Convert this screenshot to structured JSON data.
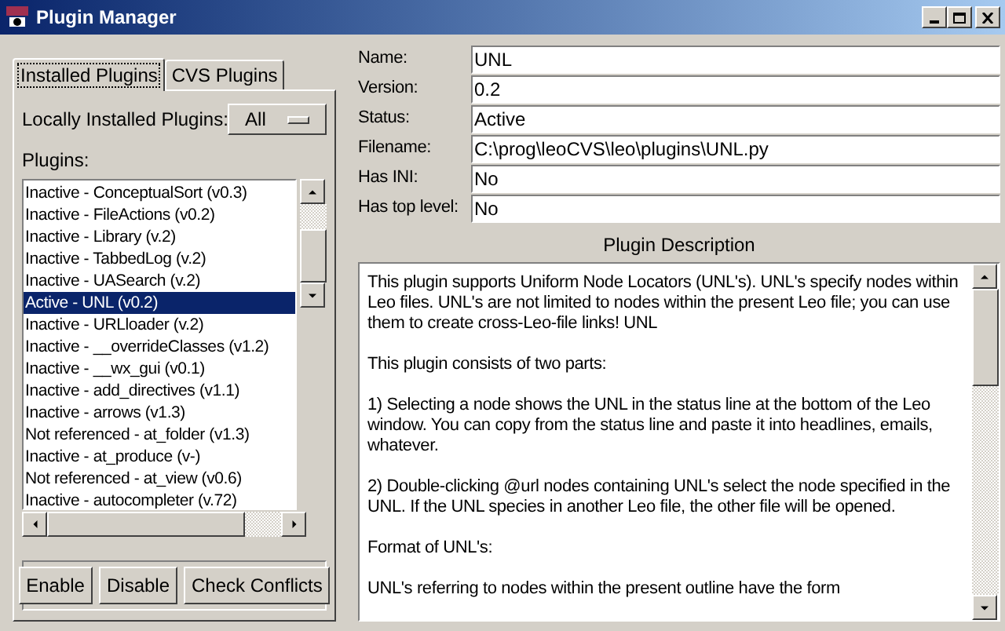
{
  "window": {
    "title": "Plugin Manager"
  },
  "tabs": [
    {
      "label": "Installed Plugins",
      "selected": true
    },
    {
      "label": "CVS Plugins",
      "selected": false
    }
  ],
  "filter": {
    "label": "Locally Installed Plugins:",
    "value": "All"
  },
  "plugins": {
    "label": "Plugins:",
    "items": [
      {
        "text": "Inactive - ConceptualSort (v0.3)",
        "selected": false
      },
      {
        "text": "Inactive - FileActions (v0.2)",
        "selected": false
      },
      {
        "text": "Inactive - Library (v.2)",
        "selected": false
      },
      {
        "text": "Inactive - TabbedLog (v.2)",
        "selected": false
      },
      {
        "text": "Inactive - UASearch (v.2)",
        "selected": false
      },
      {
        "text": "Active - UNL (v0.2)",
        "selected": true
      },
      {
        "text": "Inactive - URLloader (v.2)",
        "selected": false
      },
      {
        "text": "Inactive - __overrideClasses (v1.2)",
        "selected": false
      },
      {
        "text": "Inactive - __wx_gui (v0.1)",
        "selected": false
      },
      {
        "text": "Inactive - add_directives (v1.1)",
        "selected": false
      },
      {
        "text": "Inactive - arrows (v1.3)",
        "selected": false
      },
      {
        "text": "Not referenced - at_folder (v1.3)",
        "selected": false
      },
      {
        "text": "Inactive - at_produce (v-)",
        "selected": false
      },
      {
        "text": "Not referenced - at_view (v0.6)",
        "selected": false
      },
      {
        "text": "Inactive - autocompleter (v.72)",
        "selected": false
      }
    ]
  },
  "buttons": [
    "Enable",
    "Disable",
    "Check Conflicts"
  ],
  "details": [
    {
      "label": "Name:",
      "value": "UNL"
    },
    {
      "label": "Version:",
      "value": "0.2"
    },
    {
      "label": "Status:",
      "value": "Active"
    },
    {
      "label": "Filename:",
      "value": "C:\\prog\\leoCVS\\leo\\plugins\\UNL.py"
    },
    {
      "label": "Has INI:",
      "value": "No"
    },
    {
      "label": "Has top level:",
      "value": "No"
    }
  ],
  "description": {
    "title": "Plugin Description",
    "paragraphs": [
      "This plugin supports Uniform Node Locators (UNL's). UNL's specify nodes within Leo files. UNL's are not limited to nodes within the present Leo file; you can use them to create cross-Leo-file links! UNL",
      "This plugin consists of two parts:",
      "1) Selecting a node shows the UNL in the status line at the bottom of the Leo window. You can copy from the status line and paste it into headlines, emails, whatever.",
      "2) Double-clicking @url nodes containing UNL's select the node specified in the UNL. If the UNL species in another Leo file, the other file will be opened.",
      "Format of UNL's:",
      "UNL's referring to nodes within the present outline have the form"
    ]
  }
}
